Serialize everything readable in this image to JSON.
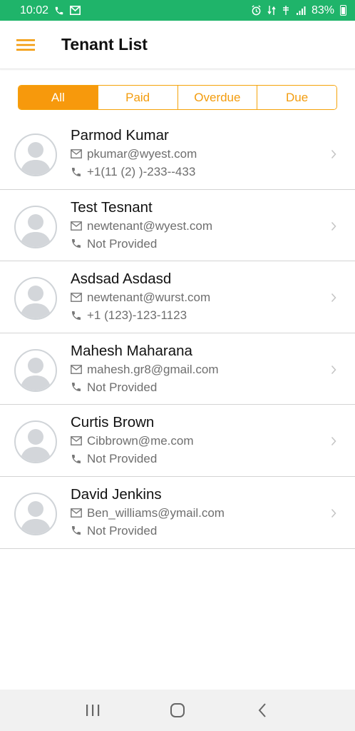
{
  "status_bar": {
    "time": "10:02",
    "battery": "83%",
    "icons": [
      "phone-icon",
      "mail-icon",
      "alarm-icon",
      "data-icon",
      "wifi-calling-icon",
      "signal-icon",
      "battery-icon"
    ]
  },
  "app_bar": {
    "title": "Tenant List",
    "menu_icon": "hamburger-menu-icon"
  },
  "filter": {
    "tabs": [
      "All",
      "Paid",
      "Overdue",
      "Due"
    ],
    "selected": "All"
  },
  "tenants": [
    {
      "name": "Parmod Kumar",
      "email": "pkumar@wyest.com",
      "phone": "+1(11 (2) )-233--433"
    },
    {
      "name": "Test Tesnant",
      "email": "newtenant@wyest.com",
      "phone": "Not Provided"
    },
    {
      "name": "Asdsad Asdasd",
      "email": "newtenant@wurst.com",
      "phone": "+1 (123)-123-1123"
    },
    {
      "name": "Mahesh Maharana",
      "email": "mahesh.gr8@gmail.com",
      "phone": "Not Provided"
    },
    {
      "name": "Curtis Brown",
      "email": "Cibbrown@me.com",
      "phone": "Not Provided"
    },
    {
      "name": "David Jenkins",
      "email": "Ben_williams@ymail.com",
      "phone": "Not Provided"
    }
  ],
  "colors": {
    "status_bar": "#1fb46a",
    "accent": "#f7990c",
    "text": "#111111",
    "muted": "#6e6e6e"
  },
  "nav_bar": {
    "buttons": [
      "recent-apps-icon",
      "home-icon",
      "back-icon"
    ]
  }
}
